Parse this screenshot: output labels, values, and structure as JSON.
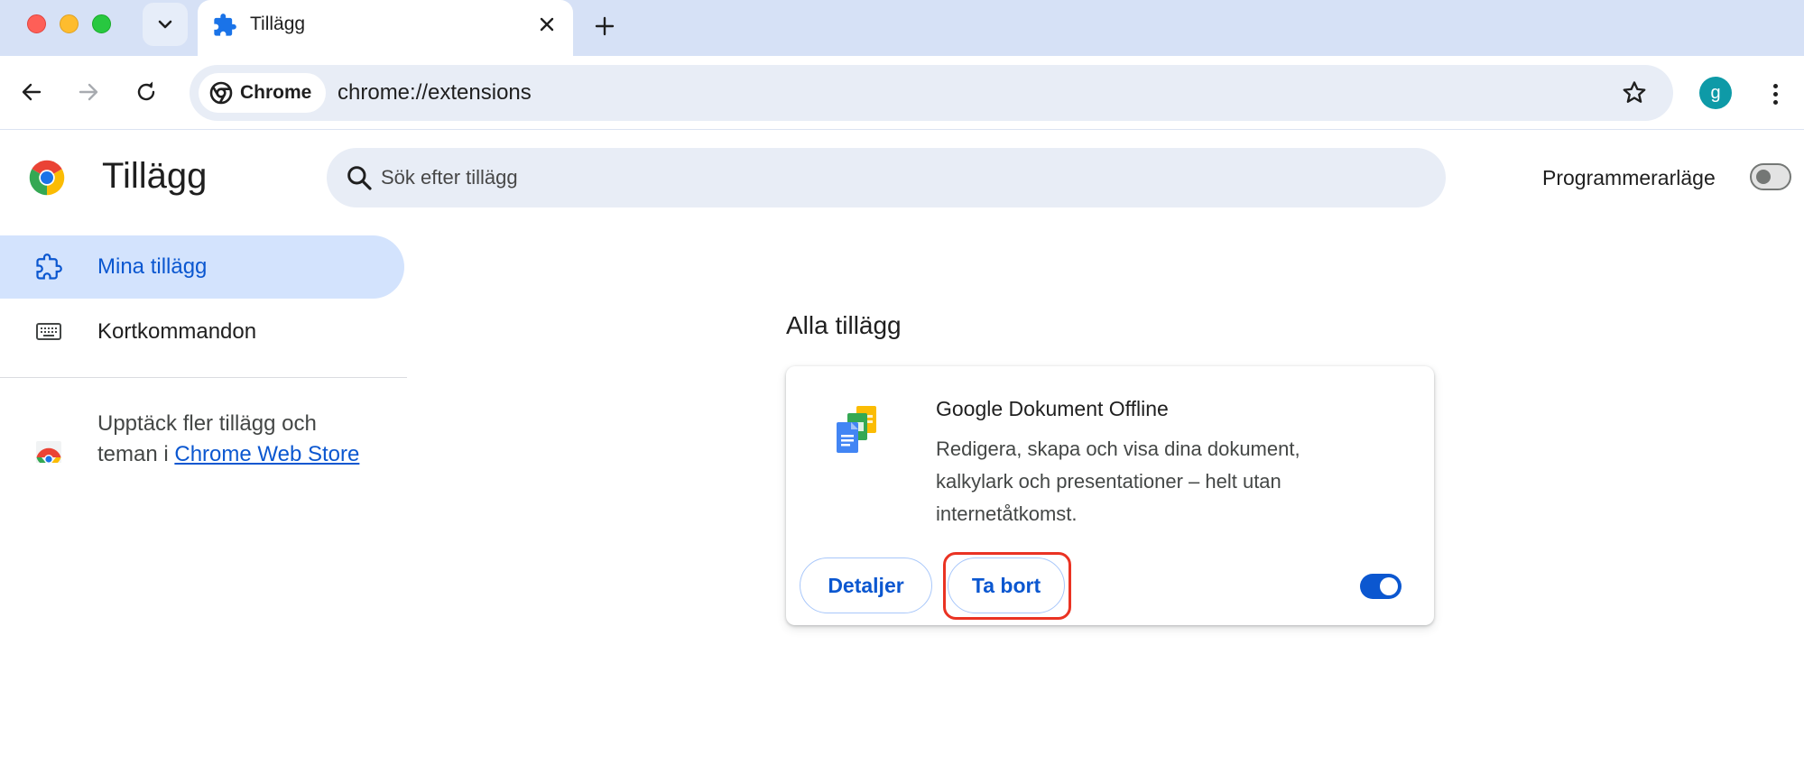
{
  "tab": {
    "title": "Tillägg"
  },
  "toolbar": {
    "chip_label": "Chrome",
    "url": "chrome://extensions",
    "avatar_letter": "g"
  },
  "header": {
    "title": "Tillägg",
    "search_placeholder": "Sök efter tillägg",
    "devmode_label": "Programmerarläge",
    "devmode_on": false
  },
  "sidebar": {
    "items": [
      {
        "label": "Mina tillägg",
        "icon": "extension-puzzle-icon",
        "active": true
      },
      {
        "label": "Kortkommandon",
        "icon": "keyboard-icon",
        "active": false
      }
    ],
    "webstore": {
      "text_before": "Upptäck fler tillägg och teman i ",
      "link_text": "Chrome Web Store"
    }
  },
  "main": {
    "section_title": "Alla tillägg",
    "extension": {
      "name": "Google Dokument Offline",
      "description": "Redigera, skapa och visa dina dokument, kalkylark och presentationer – helt utan internetåtkomst.",
      "details_label": "Detaljer",
      "remove_label": "Ta bort",
      "enabled": true
    }
  },
  "colors": {
    "accent": "#0b57d0",
    "highlight": "#ea3323",
    "tabstrip": "#d6e1f6"
  }
}
